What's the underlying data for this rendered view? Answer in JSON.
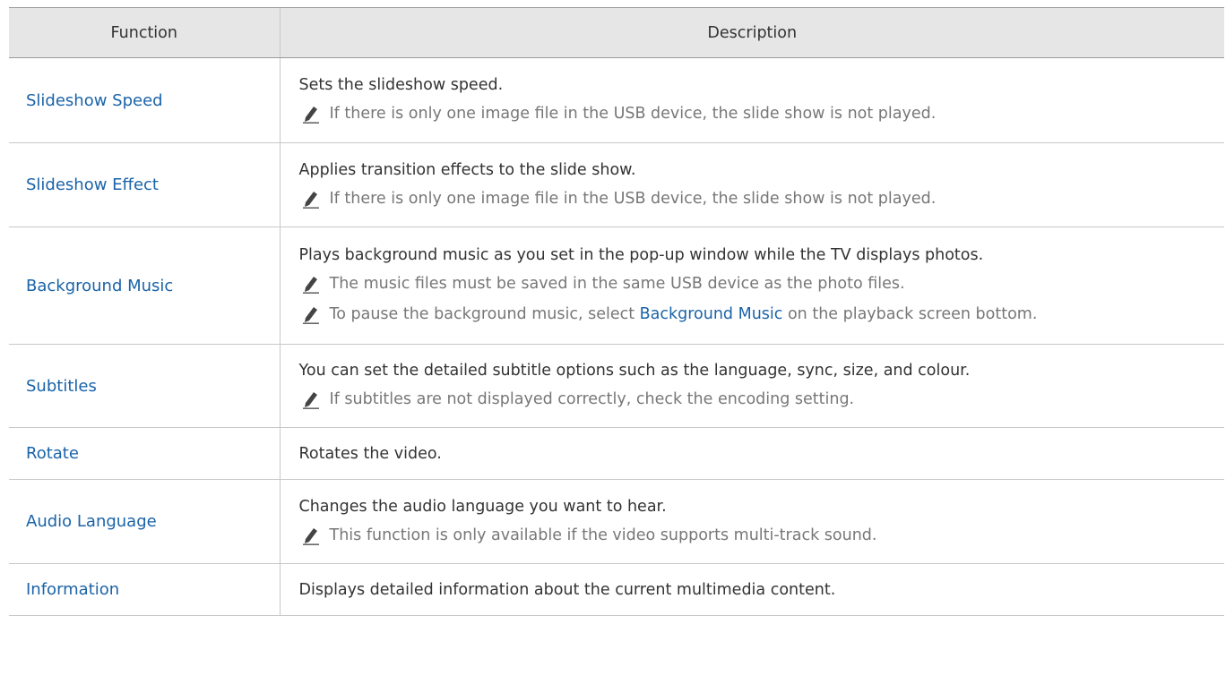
{
  "header": {
    "function": "Function",
    "description": "Description"
  },
  "rows": [
    {
      "function": "Slideshow Speed",
      "description": "Sets the slideshow speed.",
      "notes": [
        "If there is only one image file in the USB device, the slide show is not played."
      ]
    },
    {
      "function": "Slideshow Effect",
      "description": "Applies transition effects to the slide show.",
      "notes": [
        "If there is only one image file in the USB device, the slide show is not played."
      ]
    },
    {
      "function": "Background Music",
      "description": "Plays background music as you set in the pop-up window while the TV displays photos.",
      "notes": [
        "The music files must be saved in the same USB device as the photo files."
      ],
      "note_with_link": {
        "before": "To pause the background music, select ",
        "link": "Background Music",
        "after": " on the playback screen bottom."
      }
    },
    {
      "function": "Subtitles",
      "description": "You can set the detailed subtitle options such as the language, sync, size, and colour.",
      "notes": [
        "If subtitles are not displayed correctly, check the encoding setting."
      ]
    },
    {
      "function": "Rotate",
      "description": "Rotates the video.",
      "notes": []
    },
    {
      "function": "Audio Language",
      "description": "Changes the audio language you want to hear.",
      "notes": [
        "This function is only available if the video supports multi-track sound."
      ]
    },
    {
      "function": "Information",
      "description": "Displays detailed information about the current multimedia content.",
      "notes": []
    }
  ],
  "icons": {
    "note": "pencil-icon"
  },
  "colors": {
    "link": "#1a63a8",
    "note_text": "#777777",
    "header_bg": "#e6e6e6"
  }
}
